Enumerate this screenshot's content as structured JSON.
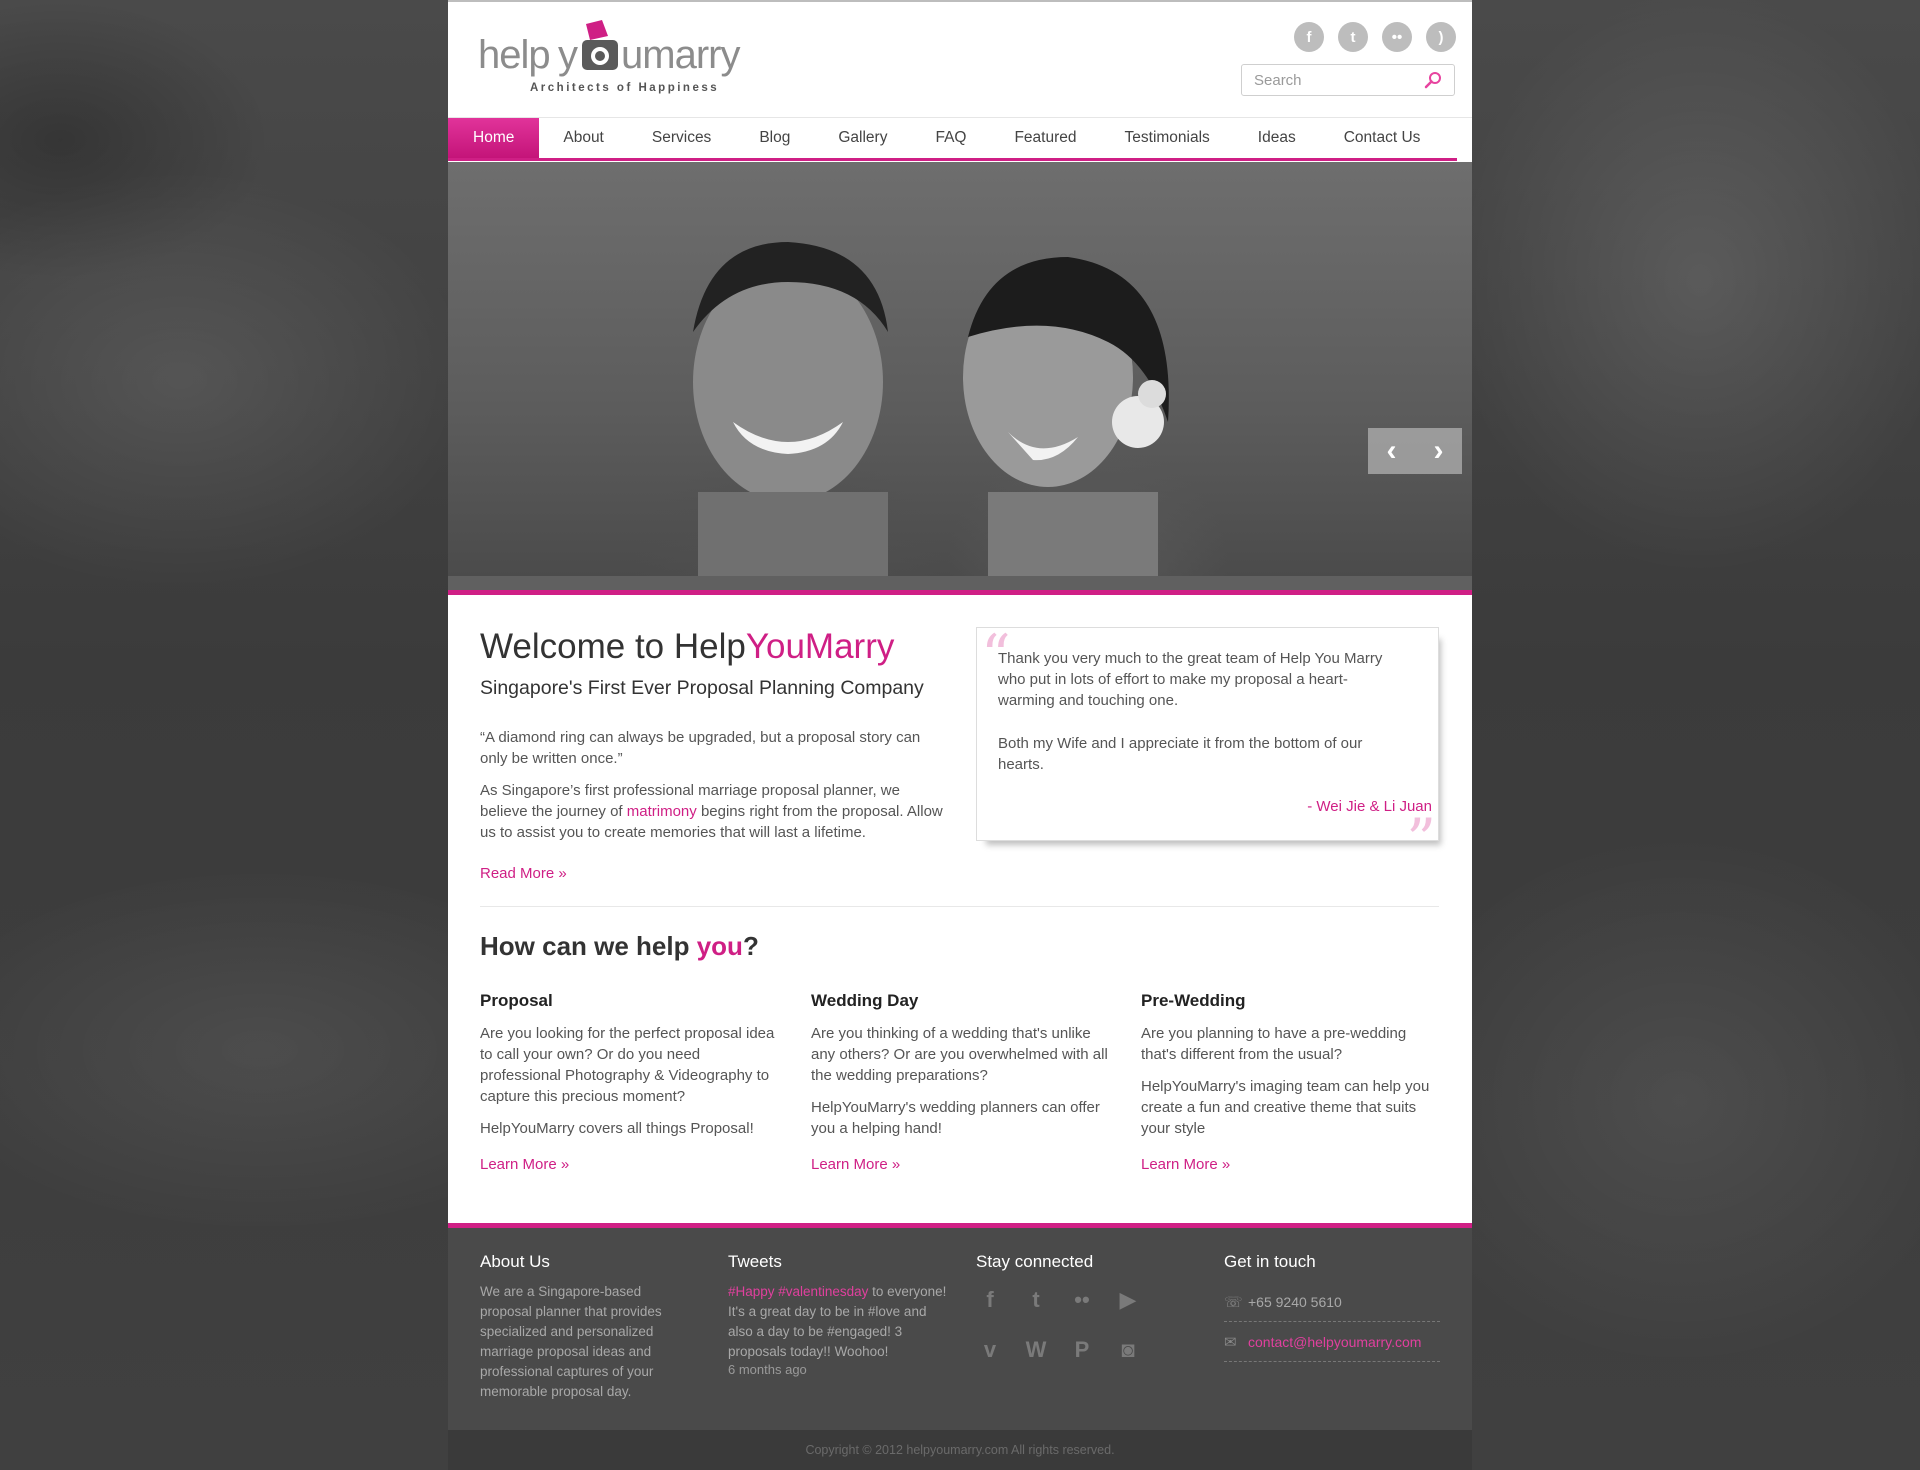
{
  "header": {
    "logo_text": "helpyoumarry",
    "logo_tagline": "Architects of Happiness",
    "social_icons": [
      "facebook-icon",
      "twitter-icon",
      "flickr-icon",
      "rss-icon"
    ],
    "search_placeholder": "Search"
  },
  "nav": {
    "items": [
      {
        "label": "Home",
        "active": true
      },
      {
        "label": "About"
      },
      {
        "label": "Services"
      },
      {
        "label": "Blog"
      },
      {
        "label": "Gallery"
      },
      {
        "label": "FAQ"
      },
      {
        "label": "Featured"
      },
      {
        "label": "Testimonials"
      },
      {
        "label": "Ideas"
      },
      {
        "label": "Contact Us"
      }
    ]
  },
  "hero": {
    "prev": "‹",
    "next": "›"
  },
  "welcome": {
    "title_plain": "Welcome to Help",
    "title_pink": "YouMarry",
    "subtitle": "Singapore's First Ever Proposal Planning Company",
    "quote": "“A diamond ring can always be upgraded, but a proposal story can only be written once.”",
    "intro_before": "As Singapore’s first professional marriage proposal planner, we believe the journey of ",
    "intro_link": "matrimony",
    "intro_after": " begins right from the proposal. Allow us to assist you to create memories that will last a lifetime.",
    "read_more": "Read More »"
  },
  "testimonial": {
    "text1": "Thank you very much to the great team of Help You Marry who put in lots of effort to make my proposal a heart-warming and touching one.",
    "text2": "Both my Wife and I appreciate it from the bottom of our hearts.",
    "author": "- Wei Jie & Li Juan"
  },
  "help": {
    "title_plain": "How can we help ",
    "title_pink": "you",
    "title_end": "?",
    "columns": [
      {
        "title": "Proposal",
        "p1": "Are you looking for the perfect proposal idea to call your own? Or do you need professional Photography & Videography to capture this precious moment?",
        "p2": "HelpYouMarry covers all things Proposal!",
        "link": "Learn More »"
      },
      {
        "title": "Wedding Day",
        "p1": "Are you thinking of a wedding that's unlike any others? Or are you overwhelmed with all the wedding preparations?",
        "p2": "HelpYouMarry's wedding planners can offer you a helping hand!",
        "link": "Learn More »"
      },
      {
        "title": "Pre-Wedding",
        "p1": "Are you planning to have a pre-wedding that's different from the usual?",
        "p2": "HelpYouMarry's imaging team can help you create a fun and creative theme that suits your style",
        "link": "Learn More »"
      }
    ]
  },
  "footer": {
    "about_title": "About Us",
    "about_text": "We are a Singapore-based proposal planner that provides specialized and personalized marriage proposal ideas and professional captures of your memorable proposal day.",
    "tweets_title": "Tweets",
    "tweet_hashtags": "#Happy #valentinesday",
    "tweet_text": " to everyone! It's a great day to be in #love and also a day to be #engaged! 3 proposals today!! Woohoo!",
    "tweet_time": "6 months ago",
    "stay_title": "Stay connected",
    "stay_icons": [
      "facebook-icon",
      "twitter-icon",
      "flickr-icon",
      "youtube-icon",
      "vimeo-icon",
      "wordpress-icon",
      "pinterest-icon",
      "instagram-icon"
    ],
    "touch_title": "Get in touch",
    "phone": "+65 9240 5610",
    "email": "contact@helpyoumarry.com",
    "copyright": "Copyright © 2012 helpyoumarry.com All rights reserved."
  },
  "colors": {
    "accent": "#cf1f85",
    "footer_bg": "#4a4a4a"
  }
}
